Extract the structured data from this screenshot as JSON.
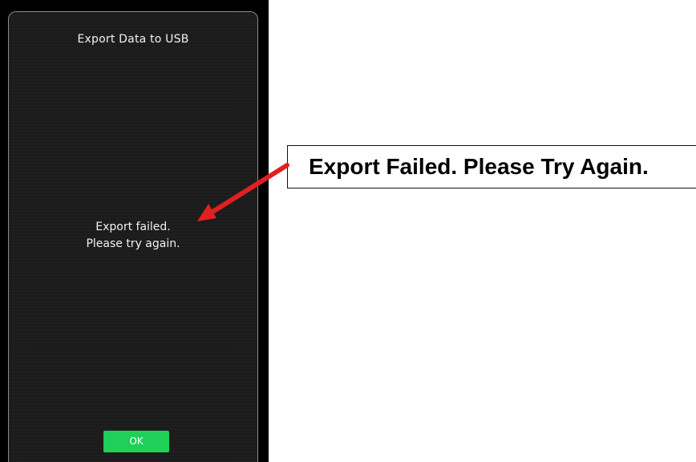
{
  "dialog": {
    "title": "Export Data to USB",
    "message_line1": "Export failed.",
    "message_line2": "Please try again.",
    "ok_label": "OK"
  },
  "callout": {
    "text": "Export Failed. Please Try Again."
  },
  "colors": {
    "screen_background": "#1b1b1b",
    "frame": "#000000",
    "ok_button": "#1fcf57",
    "arrow": "#e02020"
  }
}
